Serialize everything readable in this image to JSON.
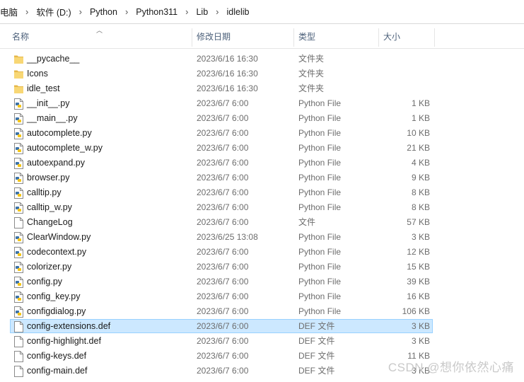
{
  "breadcrumb": [
    "电脑",
    "软件 (D:)",
    "Python",
    "Python311",
    "Lib",
    "idlelib"
  ],
  "columns": {
    "name": "名称",
    "date": "修改日期",
    "type": "类型",
    "size": "大小"
  },
  "files": [
    {
      "name": "__pycache__",
      "date": "2023/6/16 16:30",
      "type": "文件夹",
      "size": "",
      "icon": "folder-icon"
    },
    {
      "name": "Icons",
      "date": "2023/6/16 16:30",
      "type": "文件夹",
      "size": "",
      "icon": "folder-icon"
    },
    {
      "name": "idle_test",
      "date": "2023/6/16 16:30",
      "type": "文件夹",
      "size": "",
      "icon": "folder-icon"
    },
    {
      "name": "__init__.py",
      "date": "2023/6/7 6:00",
      "type": "Python File",
      "size": "1 KB",
      "icon": "python-file-icon"
    },
    {
      "name": "__main__.py",
      "date": "2023/6/7 6:00",
      "type": "Python File",
      "size": "1 KB",
      "icon": "python-file-icon"
    },
    {
      "name": "autocomplete.py",
      "date": "2023/6/7 6:00",
      "type": "Python File",
      "size": "10 KB",
      "icon": "python-file-icon"
    },
    {
      "name": "autocomplete_w.py",
      "date": "2023/6/7 6:00",
      "type": "Python File",
      "size": "21 KB",
      "icon": "python-file-icon"
    },
    {
      "name": "autoexpand.py",
      "date": "2023/6/7 6:00",
      "type": "Python File",
      "size": "4 KB",
      "icon": "python-file-icon"
    },
    {
      "name": "browser.py",
      "date": "2023/6/7 6:00",
      "type": "Python File",
      "size": "9 KB",
      "icon": "python-file-icon"
    },
    {
      "name": "calltip.py",
      "date": "2023/6/7 6:00",
      "type": "Python File",
      "size": "8 KB",
      "icon": "python-file-icon"
    },
    {
      "name": "calltip_w.py",
      "date": "2023/6/7 6:00",
      "type": "Python File",
      "size": "8 KB",
      "icon": "python-file-icon"
    },
    {
      "name": "ChangeLog",
      "date": "2023/6/7 6:00",
      "type": "文件",
      "size": "57 KB",
      "icon": "generic-file-icon"
    },
    {
      "name": "ClearWindow.py",
      "date": "2023/6/25 13:08",
      "type": "Python File",
      "size": "3 KB",
      "icon": "python-file-icon"
    },
    {
      "name": "codecontext.py",
      "date": "2023/6/7 6:00",
      "type": "Python File",
      "size": "12 KB",
      "icon": "python-file-icon"
    },
    {
      "name": "colorizer.py",
      "date": "2023/6/7 6:00",
      "type": "Python File",
      "size": "15 KB",
      "icon": "python-file-icon"
    },
    {
      "name": "config.py",
      "date": "2023/6/7 6:00",
      "type": "Python File",
      "size": "39 KB",
      "icon": "python-file-icon"
    },
    {
      "name": "config_key.py",
      "date": "2023/6/7 6:00",
      "type": "Python File",
      "size": "16 KB",
      "icon": "python-file-icon"
    },
    {
      "name": "configdialog.py",
      "date": "2023/6/7 6:00",
      "type": "Python File",
      "size": "106 KB",
      "icon": "python-file-icon"
    },
    {
      "name": "config-extensions.def",
      "date": "2023/6/7 6:00",
      "type": "DEF 文件",
      "size": "3 KB",
      "icon": "generic-file-icon",
      "selected": true
    },
    {
      "name": "config-highlight.def",
      "date": "2023/6/7 6:00",
      "type": "DEF 文件",
      "size": "3 KB",
      "icon": "generic-file-icon"
    },
    {
      "name": "config-keys.def",
      "date": "2023/6/7 6:00",
      "type": "DEF 文件",
      "size": "11 KB",
      "icon": "generic-file-icon"
    },
    {
      "name": "config-main.def",
      "date": "2023/6/7 6:00",
      "type": "DEF 文件",
      "size": "3 KB",
      "icon": "generic-file-icon"
    }
  ],
  "watermark": "CSDN @想你依然心痛",
  "colors": {
    "selection": "#cce8ff",
    "selection_border": "#99d1ff",
    "folder": "#f8d775",
    "python_blue": "#3b72a8",
    "python_yellow": "#f5c518"
  }
}
